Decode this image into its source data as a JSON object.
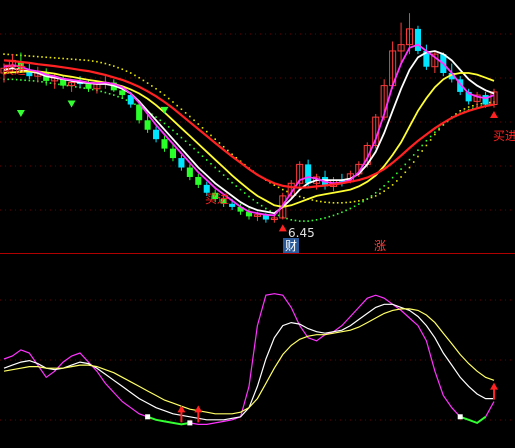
{
  "chart_data": [
    {
      "type": "candlestick",
      "panel": "price",
      "colors": {
        "up": "#ff3b3b",
        "down_fill": "#00e5ff",
        "down_fill_alt": "#29ff29",
        "ma_white": "#ffffff",
        "ma_yellow": "#ffff33",
        "ma_magenta": "#ff33ff",
        "ma_red": "#ff2222",
        "dotted_yellow": "#e8e800",
        "dotted_green": "#33ff33"
      },
      "y_domain": [
        5.9,
        13.2
      ],
      "candles": [
        {
          "i": 0,
          "o": 11.2,
          "h": 11.5,
          "l": 10.9,
          "c": 11.35,
          "d": "up"
        },
        {
          "i": 1,
          "o": 11.4,
          "h": 11.8,
          "l": 11.2,
          "c": 11.6,
          "d": "up"
        },
        {
          "i": 2,
          "o": 11.55,
          "h": 11.85,
          "l": 11.2,
          "c": 11.3,
          "d": "down"
        },
        {
          "i": 3,
          "o": 11.3,
          "h": 11.5,
          "l": 11.0,
          "c": 11.1,
          "d": "down"
        },
        {
          "i": 4,
          "o": 11.1,
          "h": 11.4,
          "l": 10.9,
          "c": 11.25,
          "d": "up"
        },
        {
          "i": 5,
          "o": 11.2,
          "h": 11.35,
          "l": 10.8,
          "c": 10.95,
          "d": "down"
        },
        {
          "i": 6,
          "o": 10.95,
          "h": 11.2,
          "l": 10.7,
          "c": 11.05,
          "d": "up"
        },
        {
          "i": 7,
          "o": 11.0,
          "h": 11.1,
          "l": 10.7,
          "c": 10.8,
          "d": "down"
        },
        {
          "i": 8,
          "o": 10.8,
          "h": 11.0,
          "l": 10.6,
          "c": 10.9,
          "d": "up"
        },
        {
          "i": 9,
          "o": 10.9,
          "h": 11.1,
          "l": 10.75,
          "c": 10.85,
          "d": "down"
        },
        {
          "i": 10,
          "o": 10.85,
          "h": 11.0,
          "l": 10.6,
          "c": 10.7,
          "d": "down"
        },
        {
          "i": 11,
          "o": 10.7,
          "h": 10.95,
          "l": 10.55,
          "c": 10.85,
          "d": "up"
        },
        {
          "i": 12,
          "o": 10.85,
          "h": 11.1,
          "l": 10.7,
          "c": 10.9,
          "d": "up"
        },
        {
          "i": 13,
          "o": 10.9,
          "h": 11.0,
          "l": 10.6,
          "c": 10.65,
          "d": "down"
        },
        {
          "i": 14,
          "o": 10.65,
          "h": 10.8,
          "l": 10.4,
          "c": 10.5,
          "d": "down"
        },
        {
          "i": 15,
          "o": 10.5,
          "h": 10.6,
          "l": 10.1,
          "c": 10.2,
          "d": "down"
        },
        {
          "i": 16,
          "o": 10.2,
          "h": 10.3,
          "l": 9.6,
          "c": 9.7,
          "d": "down"
        },
        {
          "i": 17,
          "o": 9.7,
          "h": 9.9,
          "l": 9.3,
          "c": 9.4,
          "d": "down"
        },
        {
          "i": 18,
          "o": 9.4,
          "h": 9.5,
          "l": 9.0,
          "c": 9.1,
          "d": "down"
        },
        {
          "i": 19,
          "o": 9.1,
          "h": 9.2,
          "l": 8.7,
          "c": 8.8,
          "d": "down"
        },
        {
          "i": 20,
          "o": 8.8,
          "h": 8.95,
          "l": 8.4,
          "c": 8.5,
          "d": "down"
        },
        {
          "i": 21,
          "o": 8.5,
          "h": 8.6,
          "l": 8.1,
          "c": 8.2,
          "d": "down"
        },
        {
          "i": 22,
          "o": 8.2,
          "h": 8.3,
          "l": 7.8,
          "c": 7.9,
          "d": "down"
        },
        {
          "i": 23,
          "o": 7.9,
          "h": 8.0,
          "l": 7.55,
          "c": 7.65,
          "d": "down"
        },
        {
          "i": 24,
          "o": 7.65,
          "h": 7.75,
          "l": 7.3,
          "c": 7.4,
          "d": "down"
        },
        {
          "i": 25,
          "o": 7.4,
          "h": 7.5,
          "l": 7.1,
          "c": 7.2,
          "d": "down"
        },
        {
          "i": 26,
          "o": 7.2,
          "h": 7.35,
          "l": 6.95,
          "c": 7.05,
          "d": "down"
        },
        {
          "i": 27,
          "o": 7.05,
          "h": 7.2,
          "l": 6.85,
          "c": 6.95,
          "d": "down"
        },
        {
          "i": 28,
          "o": 6.95,
          "h": 7.05,
          "l": 6.7,
          "c": 6.8,
          "d": "down"
        },
        {
          "i": 29,
          "o": 6.8,
          "h": 6.9,
          "l": 6.55,
          "c": 6.65,
          "d": "down"
        },
        {
          "i": 30,
          "o": 6.65,
          "h": 6.8,
          "l": 6.5,
          "c": 6.7,
          "d": "up"
        },
        {
          "i": 31,
          "o": 6.7,
          "h": 6.75,
          "l": 6.45,
          "c": 6.55,
          "d": "down"
        },
        {
          "i": 32,
          "o": 6.55,
          "h": 6.7,
          "l": 6.45,
          "c": 6.6,
          "d": "up"
        },
        {
          "i": 33,
          "o": 6.6,
          "h": 7.4,
          "l": 6.55,
          "c": 7.3,
          "d": "up"
        },
        {
          "i": 34,
          "o": 7.3,
          "h": 7.8,
          "l": 7.2,
          "c": 7.7,
          "d": "up"
        },
        {
          "i": 35,
          "o": 7.7,
          "h": 8.4,
          "l": 7.6,
          "c": 8.3,
          "d": "up"
        },
        {
          "i": 36,
          "o": 8.3,
          "h": 8.45,
          "l": 7.6,
          "c": 7.7,
          "d": "down"
        },
        {
          "i": 37,
          "o": 7.7,
          "h": 8.0,
          "l": 7.5,
          "c": 7.9,
          "d": "up"
        },
        {
          "i": 38,
          "o": 7.9,
          "h": 8.1,
          "l": 7.5,
          "c": 7.6,
          "d": "down"
        },
        {
          "i": 39,
          "o": 7.6,
          "h": 7.9,
          "l": 7.45,
          "c": 7.8,
          "d": "up"
        },
        {
          "i": 40,
          "o": 7.8,
          "h": 8.0,
          "l": 7.6,
          "c": 7.75,
          "d": "down"
        },
        {
          "i": 41,
          "o": 7.75,
          "h": 8.1,
          "l": 7.7,
          "c": 8.0,
          "d": "up"
        },
        {
          "i": 42,
          "o": 8.0,
          "h": 8.4,
          "l": 7.9,
          "c": 8.3,
          "d": "up"
        },
        {
          "i": 43,
          "o": 8.3,
          "h": 9.0,
          "l": 8.2,
          "c": 8.9,
          "d": "up"
        },
        {
          "i": 44,
          "o": 8.9,
          "h": 9.9,
          "l": 8.8,
          "c": 9.8,
          "d": "up"
        },
        {
          "i": 45,
          "o": 9.8,
          "h": 11.0,
          "l": 9.7,
          "c": 10.8,
          "d": "up"
        },
        {
          "i": 46,
          "o": 10.8,
          "h": 12.2,
          "l": 10.7,
          "c": 11.9,
          "d": "up"
        },
        {
          "i": 47,
          "o": 11.9,
          "h": 12.8,
          "l": 11.5,
          "c": 12.1,
          "d": "up"
        },
        {
          "i": 48,
          "o": 12.1,
          "h": 13.1,
          "l": 11.8,
          "c": 12.6,
          "d": "up"
        },
        {
          "i": 49,
          "o": 12.6,
          "h": 12.7,
          "l": 11.8,
          "c": 11.9,
          "d": "down"
        },
        {
          "i": 50,
          "o": 11.9,
          "h": 12.1,
          "l": 11.3,
          "c": 11.4,
          "d": "down"
        },
        {
          "i": 51,
          "o": 11.4,
          "h": 11.9,
          "l": 11.2,
          "c": 11.8,
          "d": "up"
        },
        {
          "i": 52,
          "o": 11.8,
          "h": 11.85,
          "l": 11.1,
          "c": 11.2,
          "d": "down"
        },
        {
          "i": 53,
          "o": 11.2,
          "h": 11.5,
          "l": 10.9,
          "c": 11.0,
          "d": "down"
        },
        {
          "i": 54,
          "o": 11.0,
          "h": 11.1,
          "l": 10.5,
          "c": 10.6,
          "d": "down"
        },
        {
          "i": 55,
          "o": 10.6,
          "h": 10.7,
          "l": 10.2,
          "c": 10.3,
          "d": "down"
        },
        {
          "i": 56,
          "o": 10.3,
          "h": 10.6,
          "l": 10.1,
          "c": 10.5,
          "d": "up"
        },
        {
          "i": 57,
          "o": 10.5,
          "h": 10.6,
          "l": 10.1,
          "c": 10.2,
          "d": "down"
        },
        {
          "i": 58,
          "o": 10.2,
          "h": 10.7,
          "l": 10.1,
          "c": 10.6,
          "d": "up"
        }
      ],
      "ma_series": [
        {
          "color_key": "ma_white",
          "values": [
            11.3,
            11.35,
            11.3,
            11.25,
            11.2,
            11.1,
            11.05,
            11.0,
            10.95,
            10.9,
            10.88,
            10.85,
            10.85,
            10.8,
            10.7,
            10.55,
            10.3,
            10.0,
            9.7,
            9.4,
            9.1,
            8.8,
            8.5,
            8.2,
            7.95,
            7.7,
            7.5,
            7.3,
            7.1,
            6.95,
            6.85,
            6.8,
            6.75,
            6.95,
            7.2,
            7.5,
            7.7,
            7.8,
            7.8,
            7.8,
            7.8,
            7.85,
            8.0,
            8.3,
            8.7,
            9.3,
            10.0,
            10.7,
            11.3,
            11.7,
            11.85,
            11.9,
            11.8,
            11.6,
            11.3,
            11.0,
            10.8,
            10.65,
            10.55
          ]
        },
        {
          "color_key": "ma_yellow",
          "values": [
            11.2,
            11.22,
            11.24,
            11.25,
            11.25,
            11.22,
            11.18,
            11.12,
            11.08,
            11.03,
            10.98,
            10.94,
            10.9,
            10.85,
            10.78,
            10.68,
            10.55,
            10.38,
            10.18,
            9.95,
            9.7,
            9.45,
            9.2,
            8.95,
            8.7,
            8.45,
            8.2,
            7.95,
            7.72,
            7.5,
            7.3,
            7.15,
            7.0,
            6.95,
            7.0,
            7.1,
            7.2,
            7.3,
            7.35,
            7.4,
            7.45,
            7.5,
            7.6,
            7.75,
            7.95,
            8.25,
            8.6,
            9.0,
            9.5,
            10.0,
            10.4,
            10.75,
            11.0,
            11.15,
            11.2,
            11.2,
            11.15,
            11.05,
            10.95
          ]
        },
        {
          "color_key": "ma_magenta",
          "values": [
            11.4,
            11.45,
            11.4,
            11.3,
            11.25,
            11.15,
            11.1,
            11.02,
            10.98,
            10.95,
            10.9,
            10.88,
            10.9,
            10.85,
            10.75,
            10.55,
            10.25,
            9.9,
            9.55,
            9.25,
            8.95,
            8.65,
            8.35,
            8.05,
            7.8,
            7.55,
            7.35,
            7.15,
            6.95,
            6.8,
            6.75,
            6.7,
            6.68,
            7.0,
            7.4,
            7.8,
            7.9,
            7.85,
            7.75,
            7.7,
            7.72,
            7.8,
            8.05,
            8.5,
            9.1,
            9.9,
            10.8,
            11.5,
            12.0,
            12.1,
            11.9,
            11.7,
            11.5,
            11.2,
            10.85,
            10.55,
            10.45,
            10.4,
            10.5
          ]
        },
        {
          "color_key": "ma_red",
          "values": [
            11.6,
            11.58,
            11.55,
            11.52,
            11.48,
            11.45,
            11.42,
            11.38,
            11.34,
            11.3,
            11.26,
            11.2,
            11.14,
            11.06,
            10.98,
            10.88,
            10.76,
            10.62,
            10.46,
            10.28,
            10.08,
            9.86,
            9.64,
            9.42,
            9.2,
            8.98,
            8.76,
            8.55,
            8.35,
            8.15,
            7.97,
            7.82,
            7.7,
            7.62,
            7.58,
            7.56,
            7.57,
            7.6,
            7.63,
            7.66,
            7.7,
            7.75,
            7.8,
            7.88,
            8.0,
            8.15,
            8.35,
            8.58,
            8.82,
            9.05,
            9.25,
            9.45,
            9.62,
            9.78,
            9.9,
            10.0,
            10.08,
            10.15,
            10.2
          ]
        }
      ],
      "dotted_series": [
        {
          "color_key": "dotted_yellow",
          "values": [
            11.8,
            11.78,
            11.76,
            11.74,
            11.72,
            11.7,
            11.68,
            11.66,
            11.64,
            11.62,
            11.6,
            11.56,
            11.5,
            11.42,
            11.32,
            11.2,
            11.05,
            10.88,
            10.7,
            10.5,
            10.28,
            10.05,
            9.82,
            9.58,
            9.34,
            9.1,
            8.86,
            8.62,
            8.4,
            8.18,
            7.98,
            7.8,
            7.64,
            7.5,
            7.38,
            7.28,
            7.2,
            7.14,
            7.1,
            7.08,
            7.08,
            7.1,
            7.14,
            7.2,
            7.3,
            7.45,
            7.65,
            7.9,
            8.2,
            8.55,
            8.9,
            9.25,
            9.55,
            9.8,
            10.0,
            10.12,
            10.2,
            10.25,
            10.28
          ]
        },
        {
          "color_key": "dotted_green",
          "values": [
            11.0,
            11.0,
            10.98,
            10.96,
            10.94,
            10.9,
            10.86,
            10.82,
            10.78,
            10.74,
            10.7,
            10.65,
            10.58,
            10.5,
            10.4,
            10.28,
            10.14,
            9.98,
            9.8,
            9.6,
            9.38,
            9.15,
            8.92,
            8.68,
            8.44,
            8.2,
            7.96,
            7.72,
            7.5,
            7.28,
            7.08,
            6.9,
            6.74,
            6.62,
            6.54,
            6.5,
            6.5,
            6.54,
            6.6,
            6.68,
            6.78,
            6.9,
            7.04,
            7.2,
            7.4,
            7.62,
            7.88,
            8.15,
            8.45,
            8.75,
            9.05,
            9.32,
            9.56,
            9.76,
            9.92,
            10.04,
            10.12,
            10.18,
            10.22
          ]
        }
      ],
      "annotations": {
        "min_price": "6.45",
        "buy_label": "买进",
        "buy_label_left": "买进",
        "buy_label_mid": "买进",
        "cai_label": "财",
        "zhang_label": "涨"
      }
    },
    {
      "type": "line",
      "panel": "indicator",
      "y_domain": [
        0,
        100
      ],
      "series": [
        {
          "color": "#ff33ff",
          "values": [
            48,
            50,
            54,
            52,
            44,
            36,
            40,
            46,
            50,
            52,
            46,
            40,
            32,
            26,
            20,
            16,
            12,
            10,
            8,
            7,
            6,
            5,
            6,
            5,
            5,
            6,
            7,
            8,
            10,
            30,
            70,
            90,
            91,
            90,
            82,
            70,
            62,
            60,
            64,
            66,
            70,
            76,
            82,
            88,
            90,
            88,
            84,
            80,
            75,
            70,
            60,
            40,
            24,
            16,
            10,
            8,
            6,
            10,
            20
          ]
        },
        {
          "color": "#ffffff",
          "values": [
            42,
            44,
            46,
            47,
            45,
            42,
            41,
            42,
            44,
            46,
            45,
            42,
            38,
            34,
            30,
            26,
            22,
            19,
            16,
            14,
            12,
            11,
            10,
            9,
            8,
            8,
            8,
            9,
            10,
            16,
            30,
            48,
            62,
            70,
            72,
            71,
            68,
            66,
            65,
            66,
            67,
            70,
            74,
            78,
            82,
            84,
            84,
            82,
            80,
            76,
            70,
            62,
            52,
            44,
            36,
            30,
            25,
            22,
            22
          ]
        },
        {
          "color": "#ffff66",
          "values": [
            40,
            41,
            42,
            43,
            43,
            42,
            42,
            42,
            43,
            44,
            44,
            43,
            41,
            39,
            36,
            33,
            30,
            27,
            24,
            21,
            19,
            17,
            15,
            14,
            13,
            12,
            12,
            12,
            13,
            16,
            22,
            32,
            42,
            51,
            57,
            61,
            63,
            64,
            64,
            65,
            66,
            67,
            69,
            72,
            75,
            78,
            80,
            81,
            81,
            80,
            77,
            72,
            65,
            58,
            51,
            45,
            40,
            36,
            34
          ]
        }
      ],
      "signals": {
        "low_segments_color": "#33ff33",
        "arrow_color": "#ff2222"
      }
    }
  ]
}
